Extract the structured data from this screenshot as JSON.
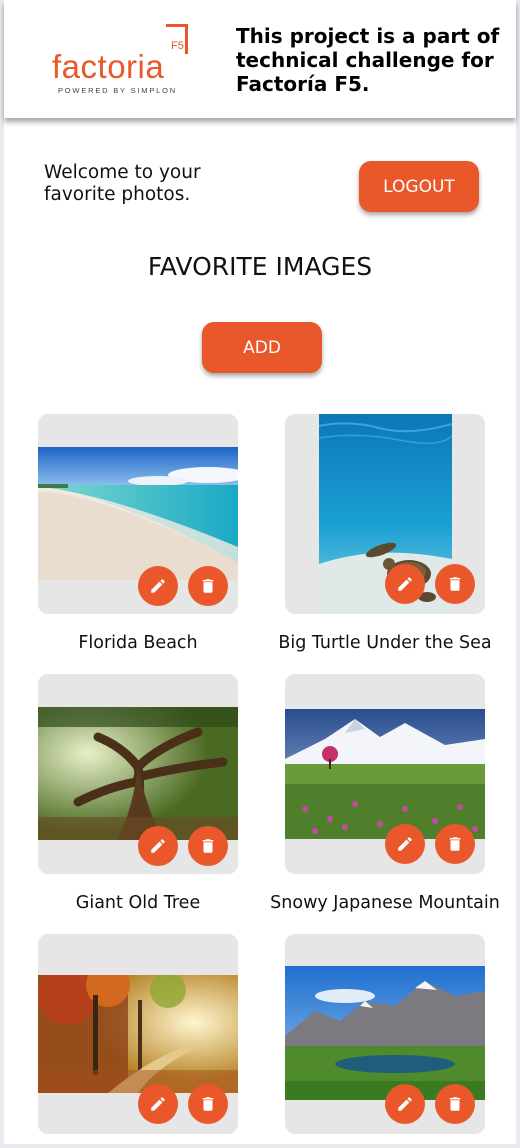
{
  "header": {
    "logo": {
      "wordmark": "factoria",
      "badge": "F5",
      "tagline": "POWERED BY SIMPLON"
    },
    "text": "This project is a part of technical challenge for Factoría F5."
  },
  "welcome_text": "Welcome to your favorite photos.",
  "logout_label": "LOGOUT",
  "page_title": "FAVORITE IMAGES",
  "add_label": "ADD",
  "accent_color": "#e9572a",
  "cards": [
    {
      "caption": "Florida Beach",
      "image": "beach-photo"
    },
    {
      "caption": "Big Turtle Under the Sea",
      "image": "turtle-photo"
    },
    {
      "caption": "Giant Old Tree",
      "image": "tree-photo"
    },
    {
      "caption": "Snowy Japanese Mountain",
      "image": "mountain-photo"
    },
    {
      "caption": "",
      "image": "autumn-forest-photo"
    },
    {
      "caption": "",
      "image": "mountain-lake-photo"
    }
  ],
  "icons": {
    "edit": "pencil-icon",
    "delete": "trash-icon"
  }
}
